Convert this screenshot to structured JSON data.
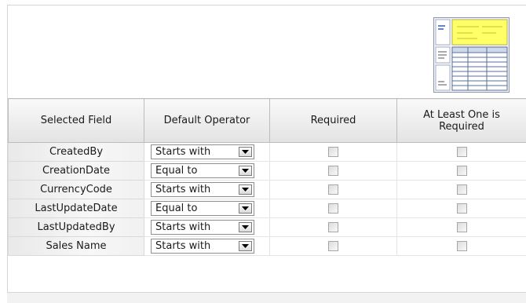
{
  "table": {
    "headers": {
      "field": "Selected Field",
      "operator": "Default Operator",
      "required": "Required",
      "at_least_one": "At Least One is Required"
    },
    "rows": [
      {
        "field": "CreatedBy",
        "operator": "Starts with",
        "required": false,
        "at_least_one": false
      },
      {
        "field": "CreationDate",
        "operator": "Equal to",
        "required": false,
        "at_least_one": false
      },
      {
        "field": "CurrencyCode",
        "operator": "Starts with",
        "required": false,
        "at_least_one": false
      },
      {
        "field": "LastUpdateDate",
        "operator": "Equal to",
        "required": false,
        "at_least_one": false
      },
      {
        "field": "LastUpdatedBy",
        "operator": "Starts with",
        "required": false,
        "at_least_one": false
      },
      {
        "field": "Sales Name",
        "operator": "Starts with",
        "required": false,
        "at_least_one": false
      }
    ]
  },
  "icons": {
    "layout": "search-layout-icon",
    "dropdown": "dropdown-arrow-icon",
    "checkbox": "checkbox-unchecked"
  },
  "colors": {
    "layout_highlight": "#ffff66",
    "layout_frame": "#8090b0",
    "header_gradient_top": "#f9f9f9",
    "header_gradient_bottom": "#e3e3e3"
  }
}
